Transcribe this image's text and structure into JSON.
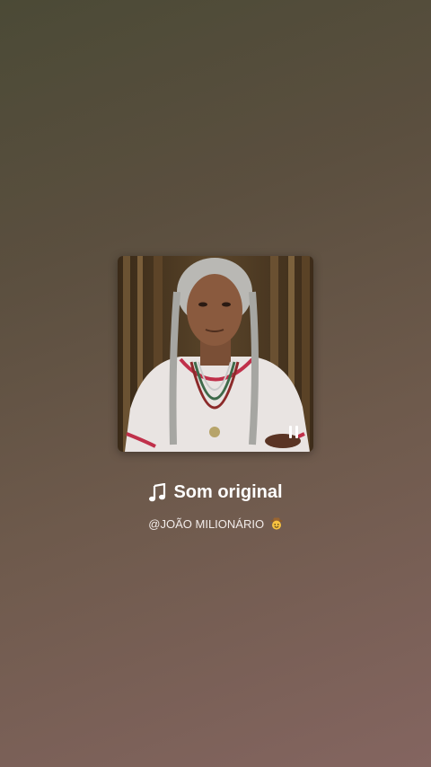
{
  "audio": {
    "title": "Som original",
    "author": "@JOÃO MILIONÁRIO",
    "state": "playing"
  },
  "icons": {
    "title_icon": "music-note-icon",
    "control_icon": "pause-icon",
    "author_emoji": "cowboy-face-emoji"
  },
  "colors": {
    "text": "#ffffff",
    "background_top": "#4b4a36",
    "background_bottom": "#846560"
  }
}
